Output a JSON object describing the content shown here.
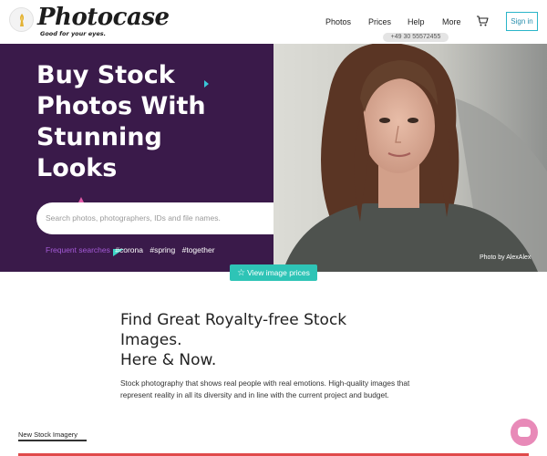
{
  "header": {
    "logo_text": "Photocase",
    "tagline": "Good for your eyes.",
    "nav": [
      "Photos",
      "Prices",
      "Help",
      "More"
    ],
    "sign_in": "Sign in",
    "phone": "+49 30 55572455"
  },
  "hero": {
    "title": [
      "Buy Stock",
      "Photos With",
      "Stunning",
      "Looks"
    ],
    "search_placeholder": "Search photos, photographers, IDs and file names.",
    "frequent_label": "Frequent searches",
    "tags": [
      "#corona",
      "#spring",
      "#together"
    ],
    "photo_credit": "Photo by AlexAlex",
    "view_prices": "View image prices"
  },
  "content": {
    "title_lines": [
      "Find Great Royalty-free Stock",
      "Images.",
      "Here & Now."
    ],
    "description": "Stock photography that shows real people with real emotions. High-quality images that represent reality in all its diversity and in line with the current project and budget.",
    "new_stock_label": "New Stock Imagery"
  },
  "colors": {
    "hero_bg": "#3a1a4a",
    "accent_teal": "#2ec4b6",
    "accent_purple": "#a35ad6",
    "signin_border": "#2bb5c9",
    "chat": "#e88ab8"
  },
  "icons": {
    "logo": "pencil-flame-icon",
    "cart": "shopping-cart-icon",
    "search": "magnifier-icon",
    "view_prices": "star-icon",
    "chat": "chat-bubble-icon"
  }
}
